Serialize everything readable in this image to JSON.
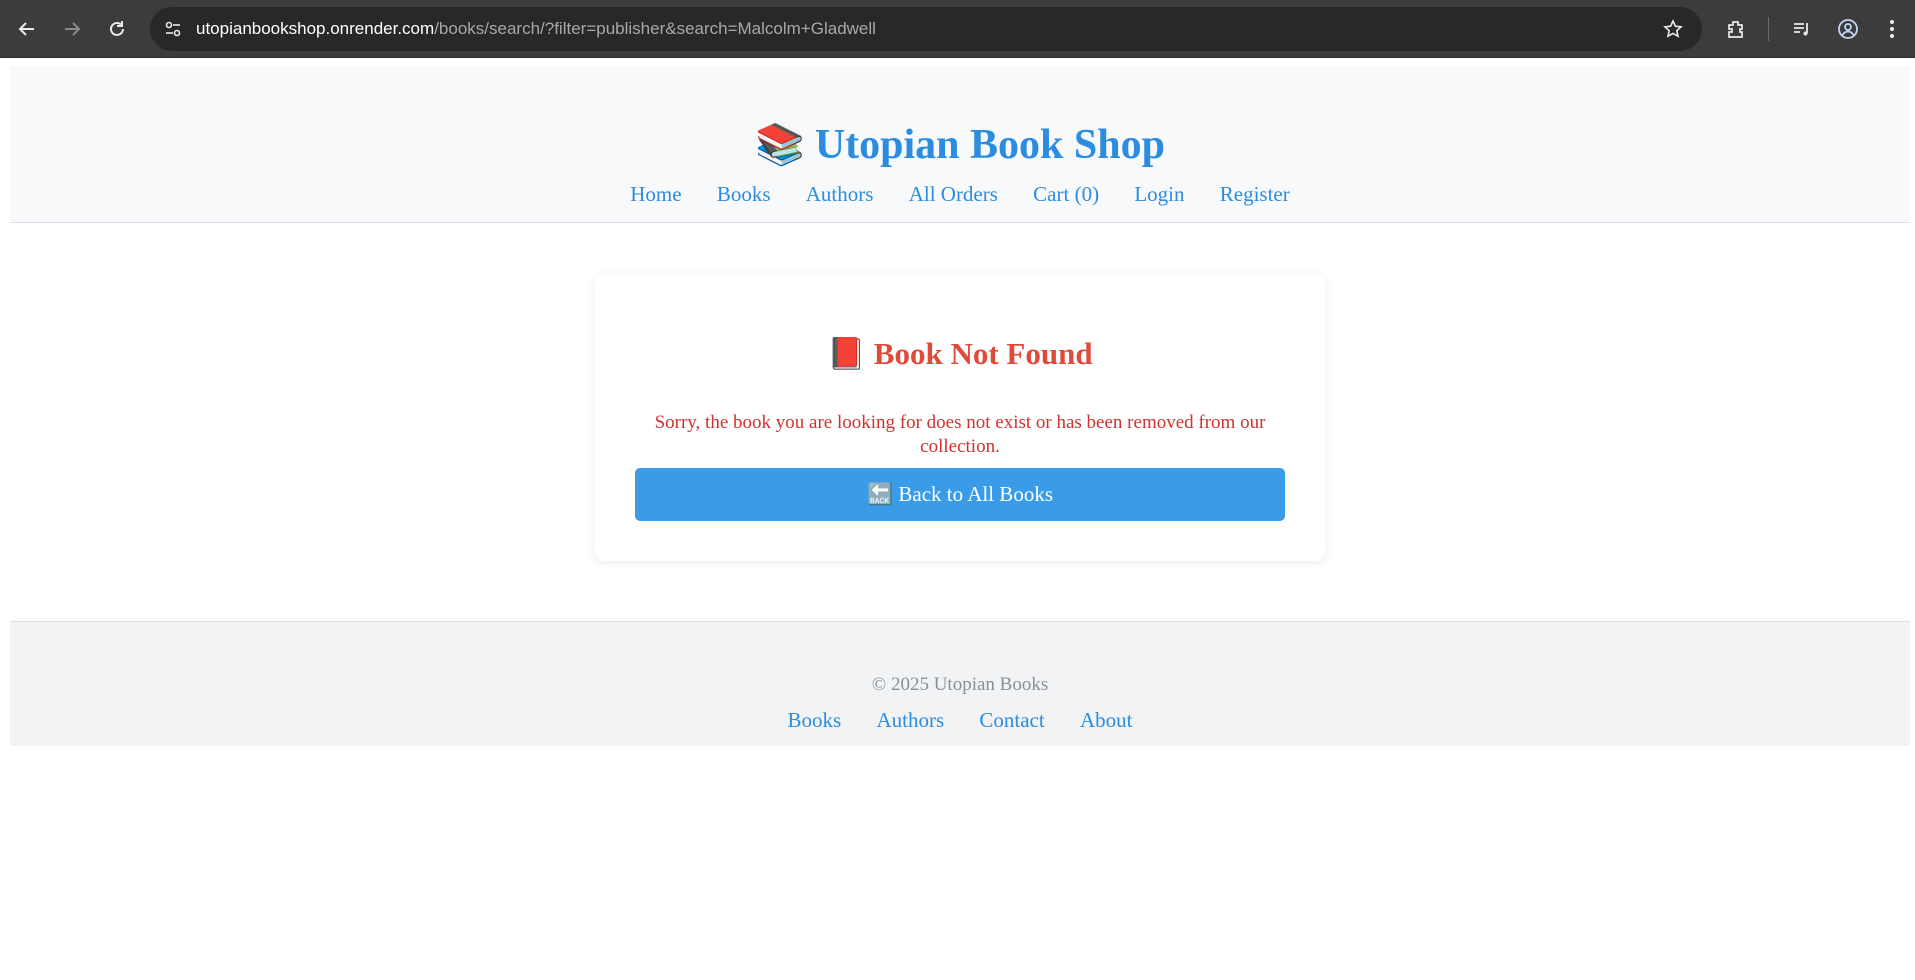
{
  "browser": {
    "url_host": "utopianbookshop.onrender.com",
    "url_path": "/books/search/?filter=publisher&search=Malcolm+Gladwell",
    "icons": [
      "back-arrow-icon",
      "forward-arrow-icon",
      "reload-icon",
      "site-info-icon",
      "star-icon",
      "extensions-icon",
      "media-icon",
      "profile-icon",
      "menu-icon"
    ]
  },
  "header": {
    "emoji": "📚",
    "title": "Utopian Book Shop",
    "nav": [
      "Home",
      "Books",
      "Authors",
      "All Orders",
      "Cart (0)",
      "Login",
      "Register"
    ]
  },
  "main": {
    "emoji": "📕",
    "heading": "Book Not Found",
    "message": "Sorry, the book you are looking for does not exist or has been removed from our collection.",
    "back_button": "🔙 Back to All Books"
  },
  "footer": {
    "copyright": "© 2025 Utopian Books",
    "links": [
      "Books",
      "Authors",
      "Contact",
      "About"
    ]
  },
  "colors": {
    "accent": "#2b8ce0",
    "error": "#e04a3a",
    "button": "#3a9ce8"
  }
}
